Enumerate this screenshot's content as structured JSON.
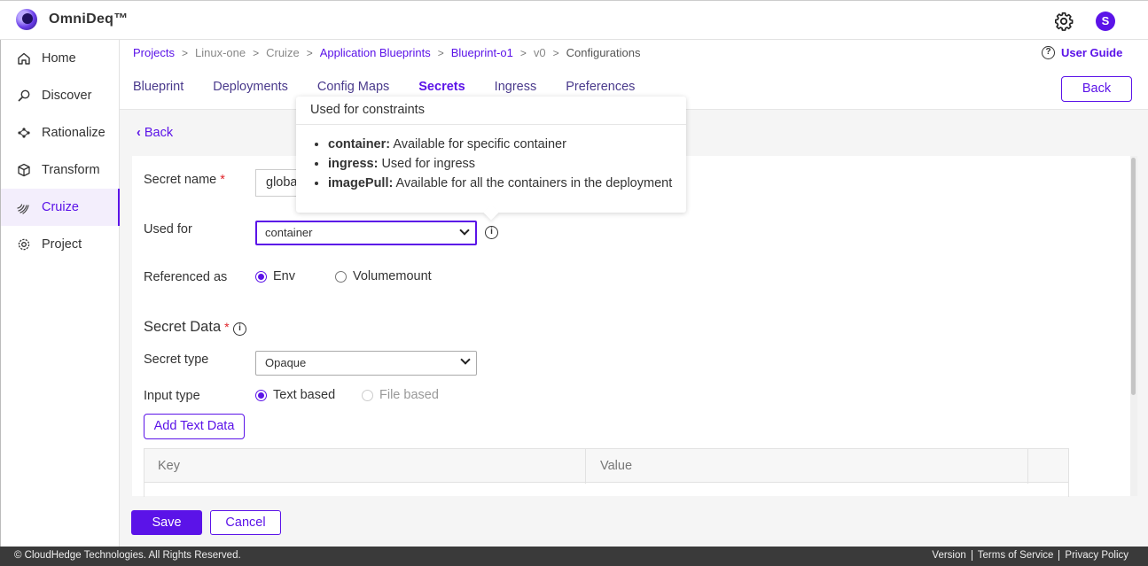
{
  "app": {
    "brand": "OmniDeq™",
    "avatar_letter": "S",
    "accent": "#5b13e8"
  },
  "sidebar": {
    "items": [
      {
        "label": "Home",
        "icon": "home-icon"
      },
      {
        "label": "Discover",
        "icon": "discover-icon"
      },
      {
        "label": "Rationalize",
        "icon": "rationalize-icon"
      },
      {
        "label": "Transform",
        "icon": "cube-icon"
      },
      {
        "label": "Cruize",
        "icon": "cruize-icon",
        "active": true
      },
      {
        "label": "Project",
        "icon": "gear-icon"
      }
    ]
  },
  "breadcrumb": {
    "items": [
      "Projects",
      "Linux-one",
      "Cruize",
      "Application Blueprints",
      "Blueprint-o1",
      "v0",
      "Configurations"
    ]
  },
  "user_guide": "User Guide",
  "tabs": [
    "Blueprint",
    "Deployments",
    "Config Maps",
    "Secrets",
    "Ingress",
    "Preferences"
  ],
  "active_tab": "Secrets",
  "back_button": "Back",
  "back_link": "Back",
  "form": {
    "secret_name_label": "Secret name",
    "secret_name_value": "globa",
    "used_for_label": "Used for",
    "used_for_value": "container",
    "referenced_as_label": "Referenced as",
    "ref_options": [
      "Env",
      "Volumemount"
    ],
    "ref_selected": "Env",
    "secret_data_title": "Secret Data",
    "secret_type_label": "Secret type",
    "secret_type_value": "Opaque",
    "input_type_label": "Input type",
    "input_options": [
      "Text based",
      "File based"
    ],
    "input_selected": "Text based",
    "add_text_data": "Add Text Data",
    "table_headers": [
      "Key",
      "Value"
    ]
  },
  "tooltip": {
    "title": "Used for constraints",
    "items": [
      {
        "term": "container:",
        "desc": " Available for specific container"
      },
      {
        "term": "ingress:",
        "desc": " Used for ingress"
      },
      {
        "term": "imagePull:",
        "desc": " Available for all the containers in the deployment"
      }
    ]
  },
  "actions": {
    "save": "Save",
    "cancel": "Cancel"
  },
  "footer": {
    "copyright": "© CloudHedge Technologies. All Rights Reserved.",
    "links": [
      "Version",
      "Terms of Service",
      "Privacy Policy"
    ]
  }
}
